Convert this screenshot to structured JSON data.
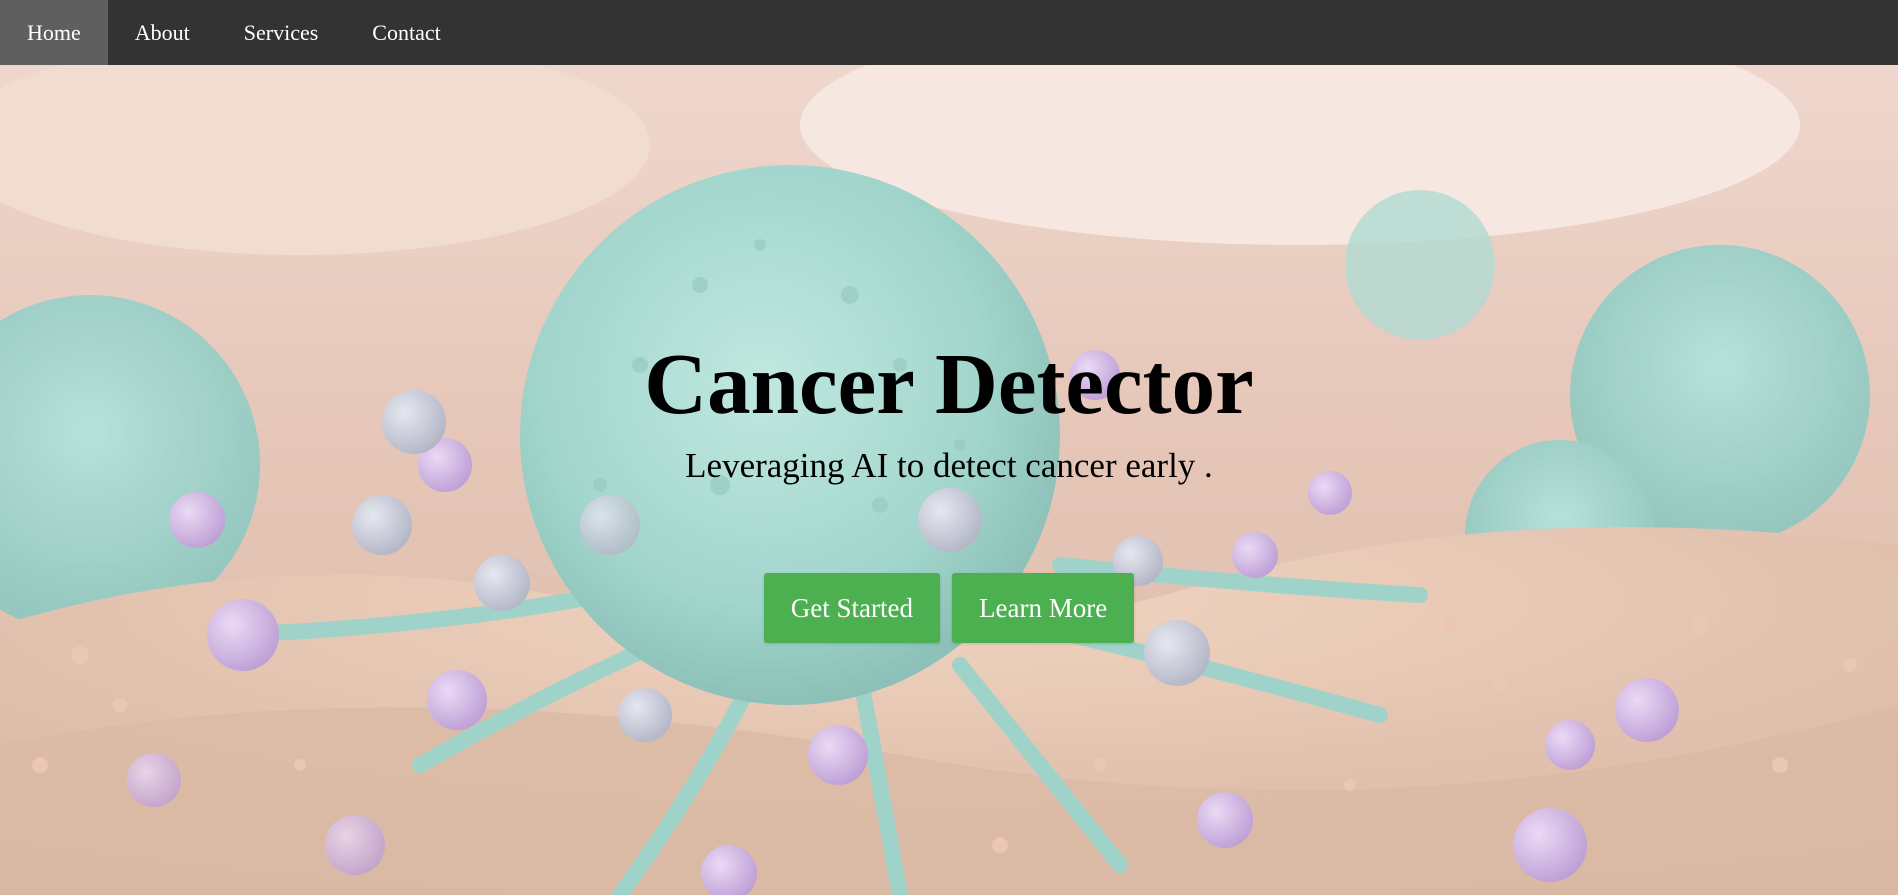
{
  "nav": {
    "items": [
      {
        "label": "Home",
        "active": true
      },
      {
        "label": "About",
        "active": false
      },
      {
        "label": "Services",
        "active": false
      },
      {
        "label": "Contact",
        "active": false
      }
    ]
  },
  "hero": {
    "title": "Cancer Detector",
    "subtitle": "Leveraging AI to detect cancer early .",
    "primary_button": "Get Started",
    "secondary_button": "Learn More",
    "background_image": "cancer-cell-illustration"
  },
  "colors": {
    "navbar": "#333333",
    "nav_active": "#5f5f5f",
    "button": "#4caf50",
    "cell_teal": "#7cc9bd",
    "tissue": "#d9a98a",
    "particle_purple": "#b98bd6"
  }
}
